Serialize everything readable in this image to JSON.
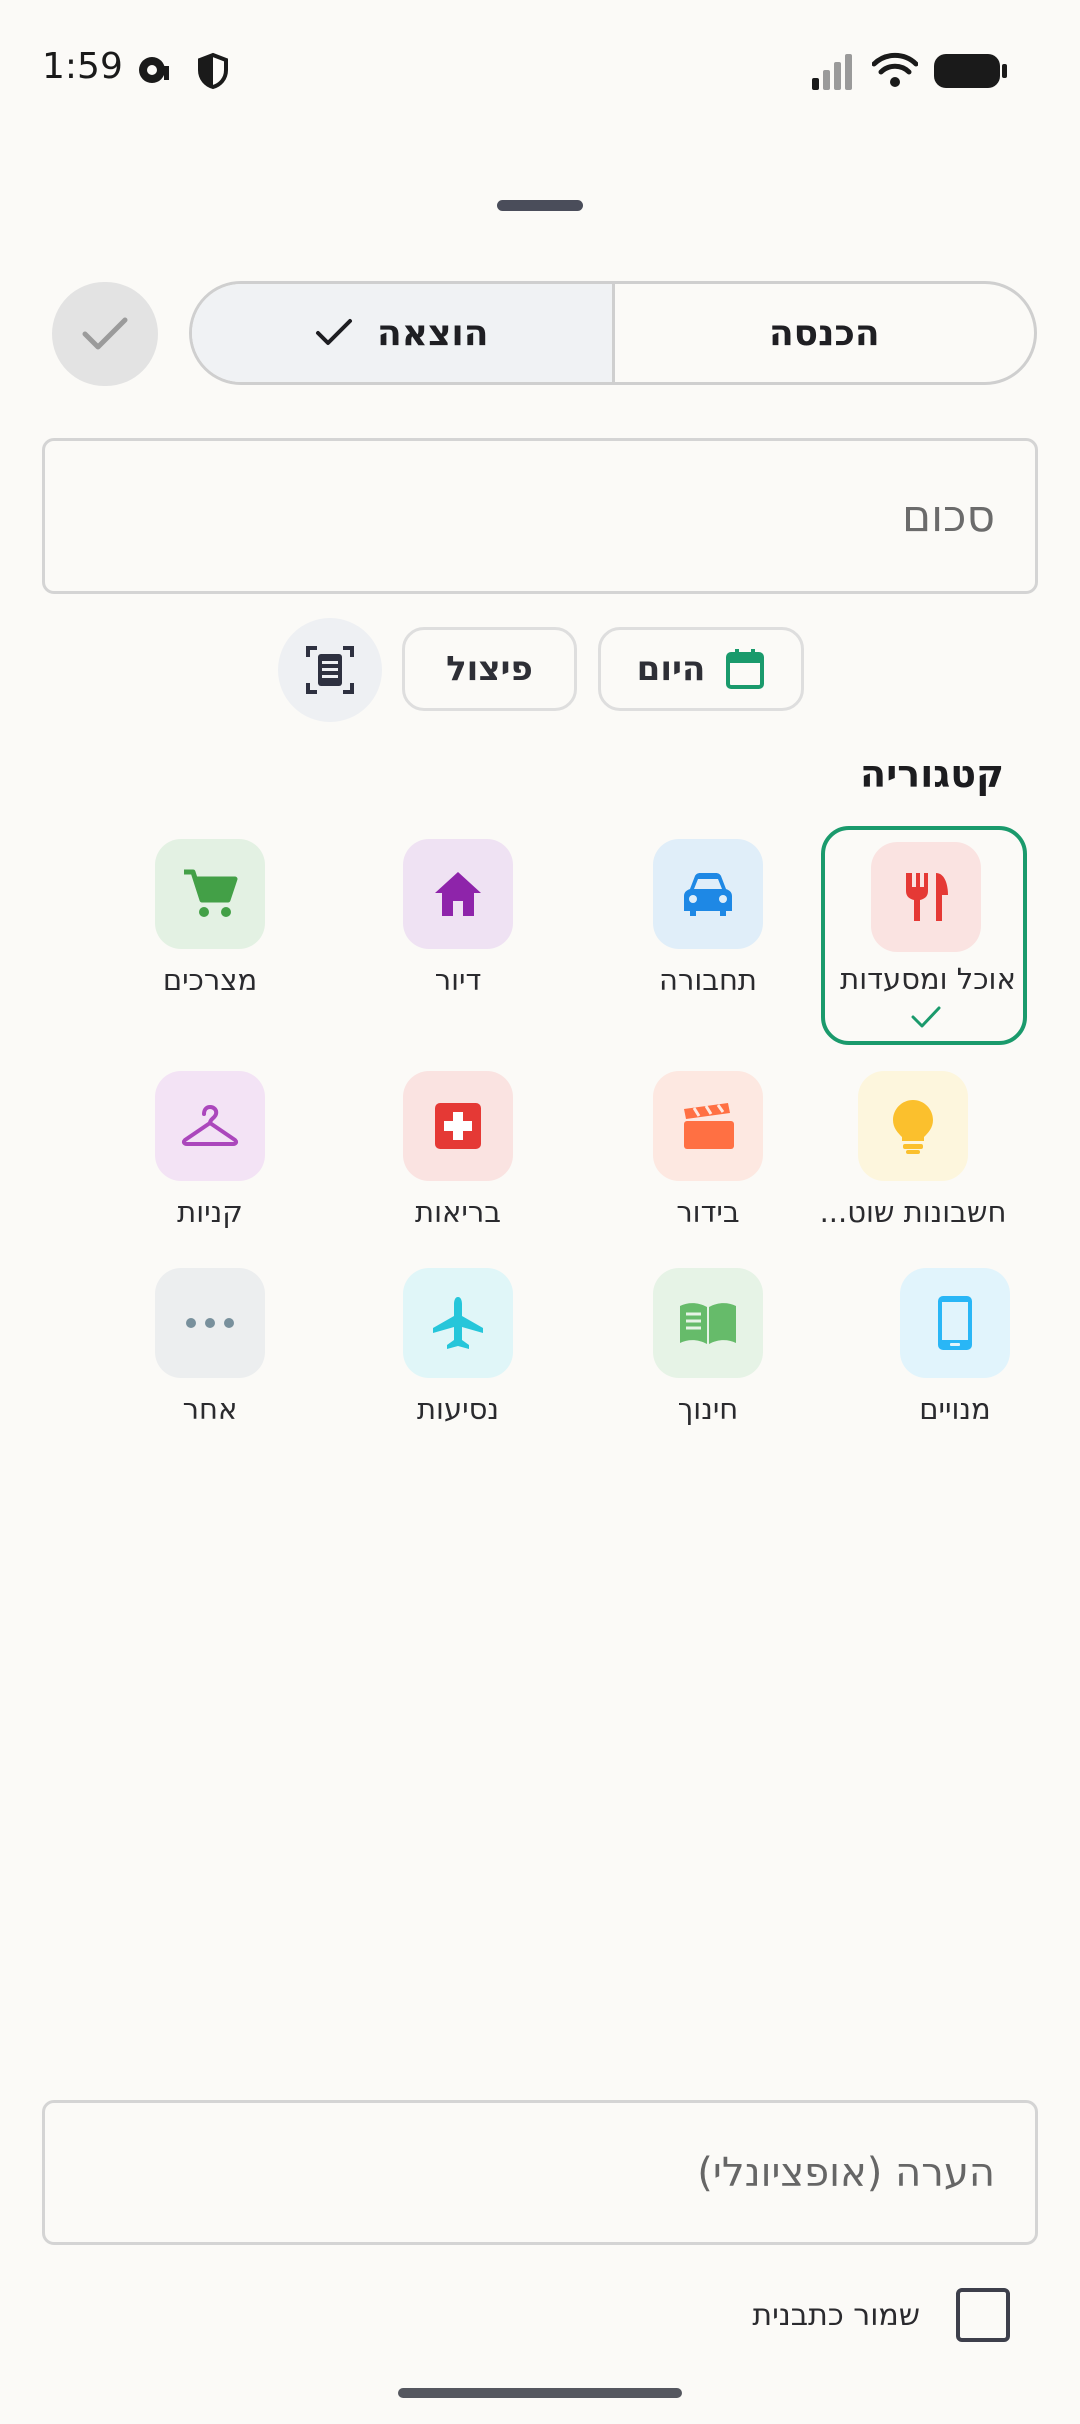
{
  "status_bar": {
    "time": "1:59"
  },
  "type_toggle": {
    "income_label": "הכנסה",
    "expense_label": "הוצאה",
    "selected": "expense"
  },
  "amount": {
    "placeholder": "סכום"
  },
  "chips": {
    "date_label": "היום",
    "split_label": "פיצול"
  },
  "category_section": {
    "title": "קטגוריה",
    "items": [
      {
        "label": "אוכל ומסעדות",
        "icon": "restaurant-icon",
        "color": "#e53935",
        "bg": "#fae3e1",
        "selected": true
      },
      {
        "label": "תחבורה",
        "icon": "car-icon",
        "color": "#1e88e5",
        "bg": "#e0eef9"
      },
      {
        "label": "דיור",
        "icon": "home-icon",
        "color": "#8e24aa",
        "bg": "#efe2f3"
      },
      {
        "label": "מצרכים",
        "icon": "cart-icon",
        "color": "#43a047",
        "bg": "#e3f1e3"
      },
      {
        "label": "חשבונות שוט...",
        "icon": "lightbulb-icon",
        "color": "#fbc02d",
        "bg": "#fdf6dd"
      },
      {
        "label": "בידור",
        "icon": "clapperboard-icon",
        "color": "#ff7043",
        "bg": "#fde8e1"
      },
      {
        "label": "בריאות",
        "icon": "medical-icon",
        "color": "#e53935",
        "bg": "#fae3e1"
      },
      {
        "label": "קניות",
        "icon": "hanger-icon",
        "color": "#ab47bc",
        "bg": "#f3e3f5"
      },
      {
        "label": "מנויים",
        "icon": "phone-icon",
        "color": "#29b6f6",
        "bg": "#e1f4fc"
      },
      {
        "label": "חינוך",
        "icon": "book-icon",
        "color": "#66bb6a",
        "bg": "#e6f3e6"
      },
      {
        "label": "נסיעות",
        "icon": "airplane-icon",
        "color": "#26c6da",
        "bg": "#e0f6f8"
      },
      {
        "label": "אחר",
        "icon": "more-icon",
        "color": "#78909c",
        "bg": "#eceeef"
      }
    ]
  },
  "note": {
    "placeholder": "הערה (אופציונלי)"
  },
  "save_template": {
    "label": "שמור כתבנית",
    "checked": false
  }
}
